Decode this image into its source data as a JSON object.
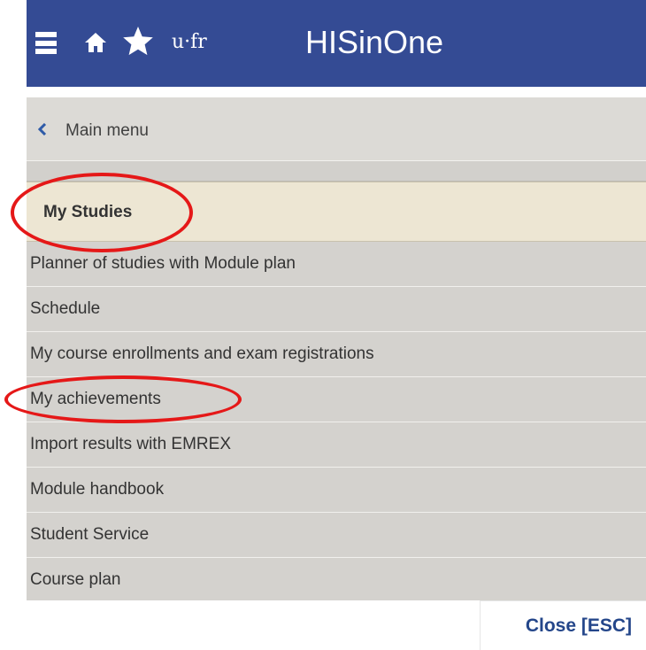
{
  "header": {
    "logo_text": "u·fr",
    "app_title": "HISinOne",
    "icons": [
      "hamburger-menu-icon",
      "home-icon",
      "star-icon"
    ],
    "background_color": "#344b94"
  },
  "menu": {
    "back_label": "Main menu",
    "section_label": "My Studies",
    "items": [
      {
        "label": "Planner of studies with Module plan"
      },
      {
        "label": "Schedule"
      },
      {
        "label": "My course enrollments and exam registrations"
      },
      {
        "label": "My achievements"
      },
      {
        "label": "Import results with EMREX"
      },
      {
        "label": "Module handbook"
      },
      {
        "label": "Student Service"
      },
      {
        "label": "Course plan"
      }
    ]
  },
  "footer": {
    "close_label": "Close [ESC]"
  },
  "annotations": {
    "highlight_color": "#e51818"
  }
}
